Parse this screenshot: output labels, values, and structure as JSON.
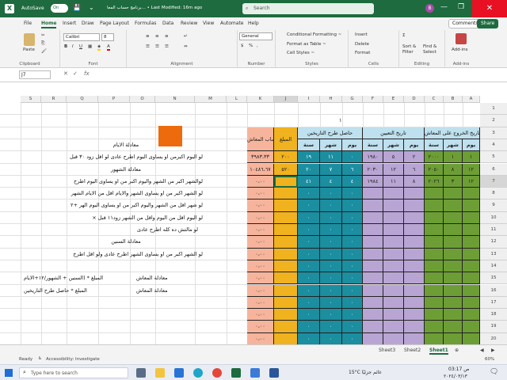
{
  "titlebar": {
    "autosave": "AutoSave",
    "toggle": "On",
    "title": "برنامج حساب المعا... • Last Modified: 16m ago",
    "search_placeholder": "Search",
    "avatar_initial": "B",
    "minimize": "—",
    "restore": "❐",
    "close": "✕"
  },
  "menu": {
    "tabs": [
      "File",
      "Home",
      "Insert",
      "Draw",
      "Page Layout",
      "Formulas",
      "Data",
      "Review",
      "View",
      "Automate",
      "Help"
    ],
    "active": "Home",
    "comments": "Comments",
    "share": "Share"
  },
  "ribbon": {
    "clipboard": {
      "paste": "Paste",
      "label": "Clipboard"
    },
    "font": {
      "name": "Calibri",
      "size": "8",
      "label": "Font"
    },
    "alignment": {
      "label": "Alignment"
    },
    "number": {
      "format": "General",
      "label": "Number"
    },
    "styles": {
      "conditional": "Conditional Formatting ~",
      "table": "Format as Table ~",
      "cell": "Cell Styles ~",
      "label": "Styles"
    },
    "cells": {
      "insert": "Insert",
      "delete": "Delete",
      "format": "Format",
      "label": "Cells"
    },
    "editing": {
      "sort": "Sort & Filter",
      "find": "Find & Select",
      "label": "Editing"
    },
    "addins": {
      "title": "Add-ins",
      "label": "Add-ins"
    }
  },
  "formula": {
    "namebox": "J7",
    "fx": "fx",
    "value": ""
  },
  "columns": [
    "A",
    "B",
    "C",
    "D",
    "E",
    "F",
    "G",
    "H",
    "I",
    "J",
    "K",
    "L",
    "M",
    "N",
    "O",
    "P",
    "Q",
    "R",
    "S"
  ],
  "rows": [
    "1",
    "2",
    "3",
    "4",
    "5",
    "6",
    "7",
    "8",
    "9",
    "10",
    "11",
    "12",
    "13",
    "14",
    "15",
    "16",
    "17",
    "18",
    "19",
    "20",
    "21",
    "22"
  ],
  "sheet": {
    "page_no": "١",
    "headers": {
      "retire": "تاريخ الخروج على المعاش",
      "hire": "تاريخ التعيين",
      "diff": "حاصل طرح التاريخين",
      "amount": "المبلغ",
      "pension": "حساب المعاش"
    },
    "sub": {
      "day": "يوم",
      "month": "شهر",
      "year": "سنة"
    },
    "data_rows": [
      {
        "a": "١",
        "b": "١",
        "c": "٢٠٠٠",
        "d": "٢",
        "e": "٥",
        "f": "١٩٨٠",
        "g": "٠",
        "h": "١١",
        "i": "١٩",
        "j": "٢٠٠",
        "k": "٣٩٨٣،٣٣"
      },
      {
        "a": "١٢",
        "b": "٨",
        "c": "٢٠٥٠",
        "d": "٦",
        "e": "١٢",
        "f": "٢٠٣٠",
        "g": "٦",
        "h": "٧",
        "i": "٢٠",
        "j": "٥٢٠",
        "k": "١٠٤٨٦،٦٧"
      },
      {
        "a": "١٢",
        "b": "٣",
        "c": "٢٠٢٦",
        "d": "٨",
        "e": "١١",
        "f": "١٩٨٤",
        "g": "٤",
        "h": "٤",
        "i": "٤١",
        "j": "",
        "k": "٠،٠٠"
      }
    ],
    "zero": "٠",
    "zero_money": "٠،٠٠",
    "notes": [
      "معادلة الايام",
      "لو اليوم اكبرمن او يساوى اليوم اطرح عادى لو اقل زود ٣٠ قبل",
      "معادلة الشهور",
      "لوالشهر اكبر من الشهر واليوم اكبر من او يساوى اليوم اطرح",
      "لو الشهر اكبر من او يساوى الشهر والايام اقل من الايام الشهر",
      "لو شهر اقل من الشهر واليوم اكبر من او يساوى اليوم الهر +٢",
      "لو اليوم اقل من اليوم واقل من الشهر زود١١ قبل ×",
      "لو مالتش ده كله اطرح عادى",
      "معادلة السنين",
      "لو الشهر اكبر من او يساوى الشهر اطرح عادى ولو اقل اطرح"
    ],
    "eq1_label": "معادلة المعاش",
    "eq1": "المبلغ * (السنين + الشهور/١٢+الايام",
    "eq2_label": "معادلة المعاش",
    "eq2": "المبلغ * حاصل طرح التاريخين"
  },
  "sheets": {
    "tabs": [
      "Sheet3",
      "Sheet2",
      "Sheet1"
    ],
    "active": "Sheet1"
  },
  "status": {
    "ready": "Ready",
    "accessibility": "Accessibility: Investigate",
    "zoom": "60%"
  },
  "taskbar": {
    "search": "Type here to search",
    "weather": "15°C  غائم جزئيًا",
    "time": "03:17 ص",
    "date": "٢٠٢٤/٠٣/١٣"
  },
  "colors": {
    "green": "#6d9e35",
    "purple": "#b8a5d4",
    "teal": "#1b8ea0",
    "gold": "#f0b21e",
    "pink": "#f6b49c",
    "header": "#bfe0ee",
    "orange": "#ed6b0c",
    "excel": "#1d6b3e"
  }
}
